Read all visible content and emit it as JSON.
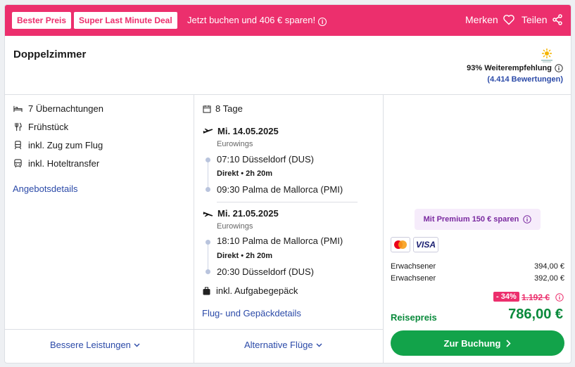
{
  "topbar": {
    "badges": [
      "Bester Preis",
      "Super Last Minute Deal"
    ],
    "promo_text": "Jetzt buchen und 406 € sparen!",
    "save_label": "Merken",
    "share_label": "Teilen",
    "bg_color": "#ec2f6d"
  },
  "room": {
    "title": "Doppelzimmer"
  },
  "rating": {
    "recommend": "93% Weiterempfehlung",
    "reviews": "(4.414 Bewertungen)"
  },
  "features": [
    {
      "icon": "bed-icon",
      "label": "7 Übernachtungen"
    },
    {
      "icon": "cutlery-icon",
      "label": "Frühstück"
    },
    {
      "icon": "train-icon",
      "label": "inkl. Zug zum Flug"
    },
    {
      "icon": "bus-icon",
      "label": "inkl. Hoteltransfer"
    }
  ],
  "offer_details_link": "Angebotsdetails",
  "trip": {
    "duration": "8 Tage",
    "outbound": {
      "date": "Mi. 14.05.2025",
      "airline": "Eurowings",
      "dep": "07:10 Düsseldorf (DUS)",
      "direct": "Direkt • 2h 20m",
      "arr": "09:30 Palma de Mallorca (PMI)"
    },
    "inbound": {
      "date": "Mi. 21.05.2025",
      "airline": "Eurowings",
      "dep": "18:10 Palma de Mallorca (PMI)",
      "direct": "Direkt • 2h 20m",
      "arr": "20:30 Düsseldorf (DUS)"
    },
    "luggage": "inkl. Aufgabegepäck",
    "details_link": "Flug- und Gepäckdetails"
  },
  "bottom": {
    "better_services": "Bessere Leistungen",
    "alt_flights": "Alternative Flüge"
  },
  "pricing": {
    "premium": "Mit Premium 150 € sparen",
    "payments": [
      "mastercard-icon",
      "VISA"
    ],
    "rows": [
      {
        "label": "Erwachsener",
        "value": "394,00 €"
      },
      {
        "label": "Erwachsener",
        "value": "392,00 €"
      }
    ],
    "discount": "- 34%",
    "old_price": "1.192 €",
    "total_label": "Reisepreis",
    "total": "786,00 €",
    "book_button": "Zur Buchung",
    "accent_green": "#12a34a"
  }
}
